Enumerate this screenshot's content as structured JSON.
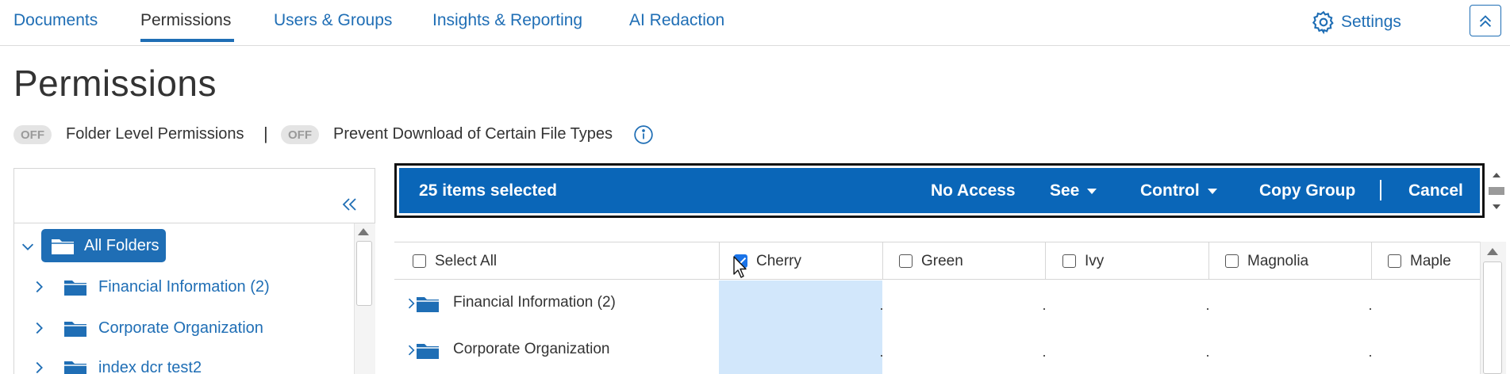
{
  "nav": {
    "tabs": [
      {
        "label": "Documents"
      },
      {
        "label": "Permissions",
        "active": true
      },
      {
        "label": "Users & Groups"
      },
      {
        "label": "Insights & Reporting"
      },
      {
        "label": "AI Redaction"
      }
    ],
    "settings_label": "Settings",
    "settings_icon": "gear-icon",
    "collapse_icon": "chevron-double-up-icon"
  },
  "page": {
    "title": "Permissions"
  },
  "toggles": {
    "folder_level": {
      "state": "OFF",
      "label": "Folder Level Permissions"
    },
    "separator": "|",
    "prevent_download": {
      "state": "OFF",
      "label": "Prevent Download of Certain File Types"
    },
    "info_icon": "info-icon"
  },
  "tree": {
    "collapse_icon": "chevron-double-left-icon",
    "root": {
      "label": "All Folders",
      "expanded": true
    },
    "items": [
      {
        "label": "Financial Information (2)"
      },
      {
        "label": "Corporate Organization"
      },
      {
        "label": "index dcr test2"
      }
    ]
  },
  "selection_bar": {
    "count_label": "25 items selected",
    "no_access": "No Access",
    "see": "See",
    "control": "Control",
    "copy_group": "Copy Group",
    "cancel": "Cancel"
  },
  "grid": {
    "select_all": "Select All",
    "columns": [
      {
        "label": "Cherry",
        "checked": true
      },
      {
        "label": "Green",
        "checked": false
      },
      {
        "label": "Ivy",
        "checked": false
      },
      {
        "label": "Magnolia",
        "checked": false
      },
      {
        "label": "Maple",
        "checked": false
      }
    ],
    "rows": [
      {
        "label": "Financial Information (2)"
      },
      {
        "label": "Corporate Organization"
      }
    ]
  },
  "colors": {
    "brand_blue": "#1f6eb5",
    "selection_bar": "#0a66b8",
    "highlight_column": "#d2e7fb"
  }
}
